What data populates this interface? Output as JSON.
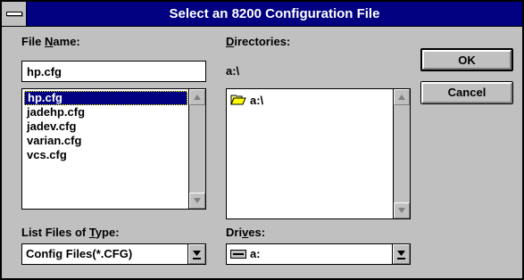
{
  "window": {
    "title": "Select an 8200 Configuration File"
  },
  "file_name": {
    "label_pre": "File ",
    "label_accel": "N",
    "label_post": "ame:",
    "value": "hp.cfg"
  },
  "files": {
    "items": [
      "hp.cfg",
      "jadehp.cfg",
      "jadev.cfg",
      "varian.cfg",
      "vcs.cfg"
    ],
    "selected": "hp.cfg"
  },
  "directories": {
    "label_pre": "",
    "label_accel": "D",
    "label_post": "irectories:",
    "current_path": "a:\\",
    "items": [
      {
        "label": "a:\\",
        "icon": "open-folder-icon"
      }
    ]
  },
  "file_type": {
    "label_pre": "List Files of ",
    "label_accel": "T",
    "label_post": "ype:",
    "value": "Config Files(*.CFG)"
  },
  "drives": {
    "label_pre": "Dri",
    "label_accel": "v",
    "label_post": "es:",
    "value": "a:",
    "icon": "floppy-drive-icon"
  },
  "buttons": {
    "ok": "OK",
    "cancel": "Cancel"
  },
  "colors": {
    "titlebar": "#000080",
    "selection": "#000080",
    "face": "#c0c0c0"
  }
}
